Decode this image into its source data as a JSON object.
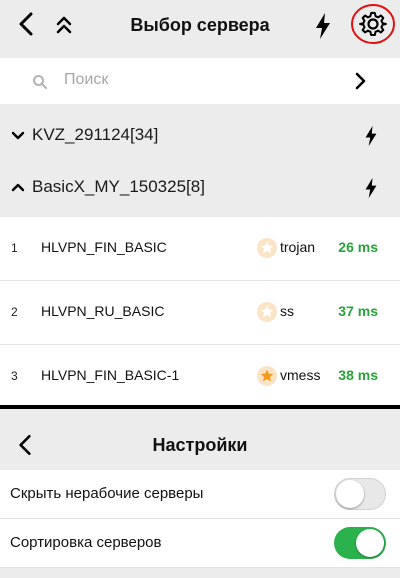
{
  "header": {
    "title": "Выбор сервера",
    "back_icon": "chevron-left-icon",
    "collapse_icon": "double-chevron-up-icon",
    "ping_icon": "lightning-icon",
    "settings_icon": "gear-icon",
    "settings_highlight_color": "#e01010"
  },
  "search": {
    "placeholder": "Поиск",
    "search_icon": "search-icon",
    "go_icon": "chevron-right-icon"
  },
  "groups": [
    {
      "label": "KVZ_291124[34]",
      "expanded": false
    },
    {
      "label": "BasicX_MY_150325[8]",
      "expanded": true
    }
  ],
  "servers": [
    {
      "index": "1",
      "name": "HLVPN_FIN_BASIC",
      "protocol": "trojan",
      "ping": "26 ms",
      "favorite": false
    },
    {
      "index": "2",
      "name": "HLVPN_RU_BASIC",
      "protocol": "ss",
      "ping": "37 ms",
      "favorite": false
    },
    {
      "index": "3",
      "name": "HLVPN_FIN_BASIC-1",
      "protocol": "vmess",
      "ping": "38 ms",
      "favorite": true
    }
  ],
  "settings": {
    "title": "Настройки",
    "items": [
      {
        "label": "Скрыть нерабочие серверы",
        "enabled": false
      },
      {
        "label": "Сортировка серверов",
        "enabled": true
      }
    ]
  },
  "colors": {
    "ping_green": "#27a33a",
    "toggle_on": "#2bb24c",
    "star_active": "#f39a1c",
    "star_inactive": "#fbe3c6"
  }
}
